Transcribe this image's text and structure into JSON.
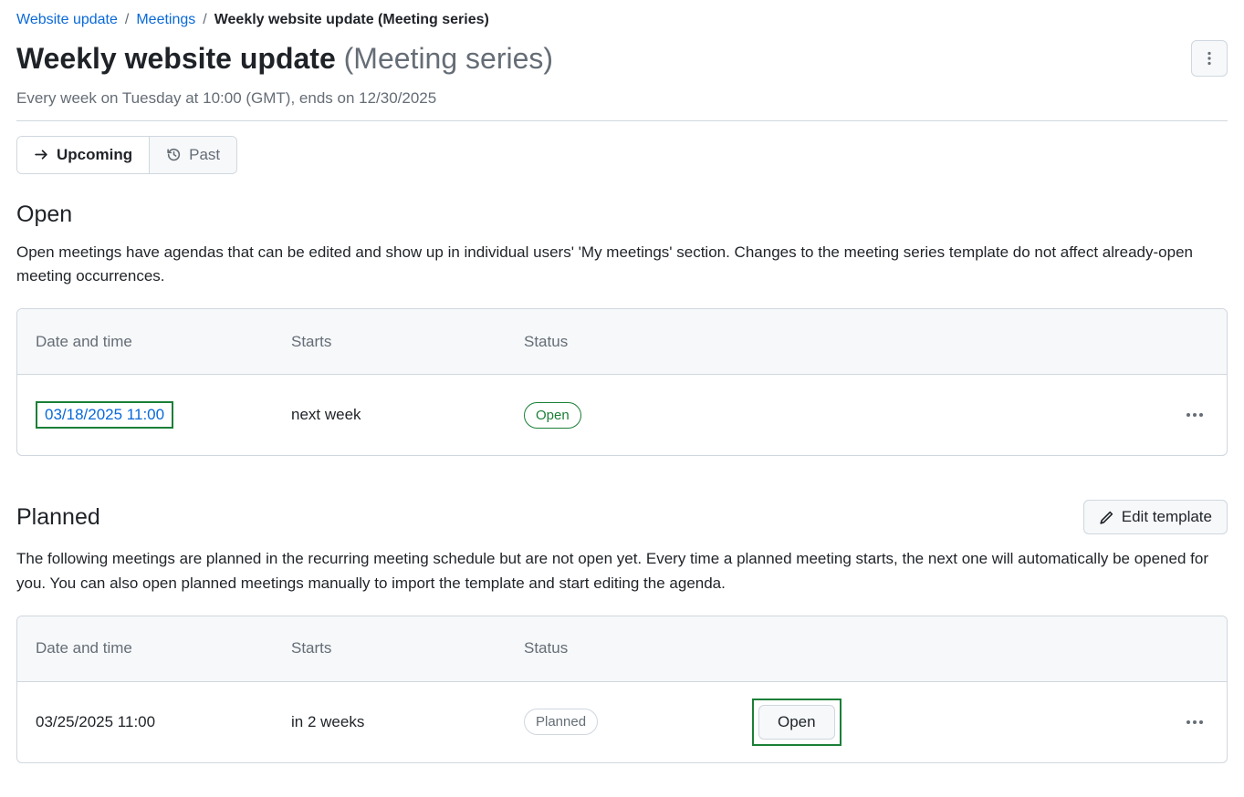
{
  "breadcrumb": {
    "items": [
      {
        "label": "Website update",
        "link": true
      },
      {
        "label": "Meetings",
        "link": true
      },
      {
        "label": "Weekly website update (Meeting series)",
        "link": false
      }
    ]
  },
  "header": {
    "title_main": "Weekly website update",
    "title_suffix": "(Meeting series)",
    "subtitle": "Every week on Tuesday at 10:00 (GMT), ends on 12/30/2025"
  },
  "tabs": {
    "upcoming": "Upcoming",
    "past": "Past"
  },
  "open_section": {
    "title": "Open",
    "description": "Open meetings have agendas that can be edited and show up in individual users' 'My meetings' section. Changes to the meeting series template do not affect already-open meeting occurrences.",
    "columns": {
      "datetime": "Date and time",
      "starts": "Starts",
      "status": "Status"
    },
    "rows": [
      {
        "datetime": "03/18/2025 11:00",
        "starts": "next week",
        "status": "Open"
      }
    ]
  },
  "planned_section": {
    "title": "Planned",
    "edit_template_label": "Edit template",
    "description": "The following meetings are planned in the recurring meeting schedule but are not open yet. Every time a planned meeting starts, the next one will automatically be opened for you. You can also open planned meetings manually to import the template and start editing the agenda.",
    "columns": {
      "datetime": "Date and time",
      "starts": "Starts",
      "status": "Status"
    },
    "rows": [
      {
        "datetime": "03/25/2025 11:00",
        "starts": "in 2 weeks",
        "status": "Planned",
        "open_button": "Open"
      }
    ]
  }
}
